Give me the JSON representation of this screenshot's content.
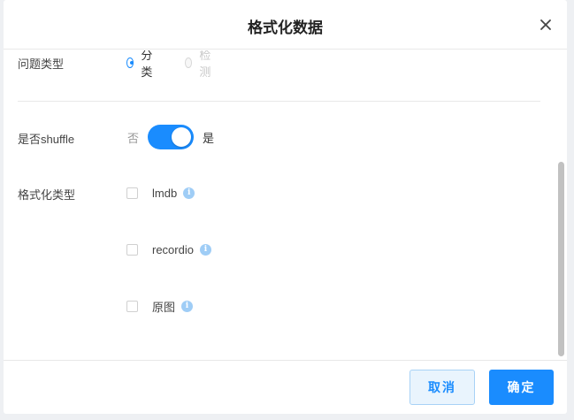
{
  "dialog": {
    "title": "格式化数据",
    "close_icon": "close-icon"
  },
  "problem_type": {
    "label": "问题类型",
    "options": [
      {
        "label": "分类",
        "checked": true,
        "disabled": false
      },
      {
        "label": "检测",
        "checked": false,
        "disabled": true
      }
    ]
  },
  "shuffle": {
    "label": "是否shuffle",
    "off_label": "否",
    "on_label": "是",
    "enabled": true
  },
  "format_type": {
    "label": "格式化类型",
    "options": [
      {
        "label": "lmdb",
        "checked": false,
        "info_icon": "info-icon"
      },
      {
        "label": "recordio",
        "checked": false,
        "info_icon": "info-icon"
      },
      {
        "label": "原图",
        "checked": false,
        "info_icon": "info-icon"
      }
    ]
  },
  "footer": {
    "cancel_label": "取消",
    "confirm_label": "确定"
  },
  "colors": {
    "accent": "#1a8cfe",
    "cancel_bg": "#e9f4fd",
    "info_icon": "#9fcdf6"
  }
}
